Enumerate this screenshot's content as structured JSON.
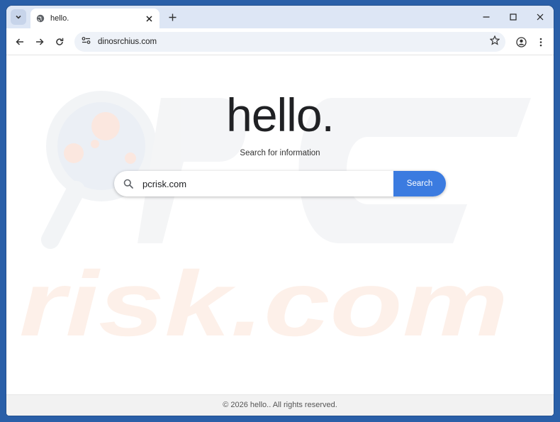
{
  "tab": {
    "title": "hello."
  },
  "omnibox": {
    "url": "dinosrchius.com"
  },
  "page": {
    "heading": "hello.",
    "subtitle": "Search for information",
    "search_value": "pcrisk.com",
    "search_button": "Search",
    "footer": "© 2026 hello.. All rights reserved."
  },
  "watermark": {
    "text": "risk.com",
    "logo_letters": "PC"
  },
  "icons": {
    "tab_search": "chevron-down-icon",
    "tab_favicon": "globe-icon",
    "tab_close": "close-icon",
    "new_tab": "plus-icon",
    "minimize": "minimize-icon",
    "maximize": "maximize-icon",
    "close": "close-icon",
    "back": "back-arrow-icon",
    "forward": "forward-arrow-icon",
    "reload": "reload-icon",
    "site_info": "site-settings-icon",
    "bookmark": "star-icon",
    "profile": "profile-icon",
    "menu": "kebab-menu-icon",
    "search": "search-icon"
  },
  "colors": {
    "desktop": "#2a5fa8",
    "tabstrip": "#dde6f5",
    "search_button": "#3b7be0",
    "footer_bg": "#f2f2f2"
  }
}
